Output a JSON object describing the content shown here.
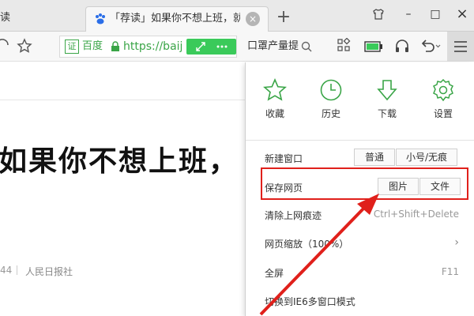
{
  "tabs": {
    "left_fragment": "读",
    "active": {
      "title": "「荐读」如果你不想上班，就到最",
      "close": "×"
    },
    "new_tab": "+"
  },
  "window_controls": {
    "shirt": "skin-icon",
    "minimize": "–",
    "maximize": "□",
    "close": "×"
  },
  "toolbar": {
    "site_name": "百度",
    "url": "https://baij",
    "search_text": "口罩产量提"
  },
  "page": {
    "headline": "如果你不想上班，",
    "meta_time": "44",
    "meta_source": "人民日报社"
  },
  "menu": {
    "quick": [
      {
        "label": "收藏",
        "icon": "star-icon"
      },
      {
        "label": "历史",
        "icon": "clock-icon"
      },
      {
        "label": "下载",
        "icon": "download-icon"
      },
      {
        "label": "设置",
        "icon": "gear-icon"
      }
    ],
    "new_window": {
      "label": "新建窗口",
      "normal": "普通",
      "small": "小号/无痕"
    },
    "save_page": {
      "label": "保存网页",
      "image": "图片",
      "file": "文件"
    },
    "clear_history": {
      "label": "清除上网痕迹",
      "shortcut": "Ctrl+Shift+Delete"
    },
    "zoom": {
      "label": "网页缩放（100%）",
      "chevron": "›"
    },
    "fullscreen": {
      "label": "全屏",
      "shortcut": "F11"
    },
    "ie6": {
      "label": "切换到IE6多窗口模式"
    }
  },
  "colors": {
    "accent_green": "#3aa547",
    "highlight_red": "#e0201b"
  }
}
